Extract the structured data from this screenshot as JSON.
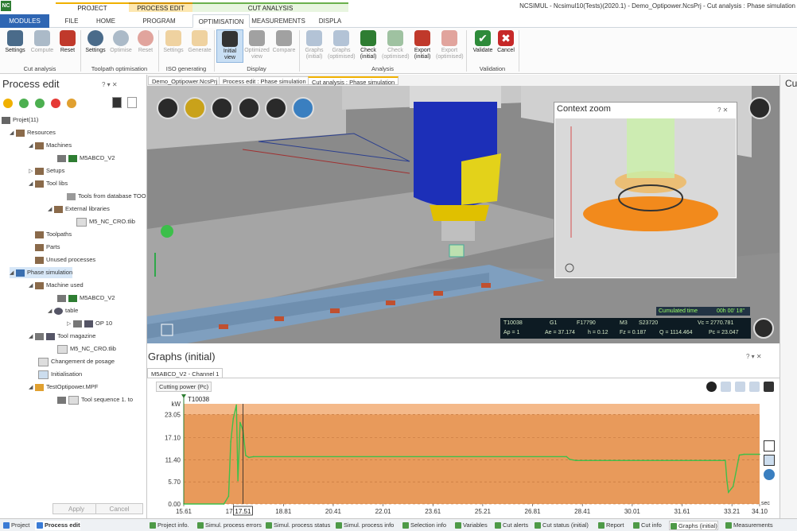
{
  "window": {
    "logo": "NC",
    "title": "NCSIMUL - Ncsimul10(Tests)(2020.1) - Demo_Optipower.NcsPrj - Cut analysis : Phase simulation",
    "context_groups": [
      "PROJECT",
      "PROCESS EDIT",
      "CUT ANALYSIS"
    ]
  },
  "ribbon": {
    "tabs": [
      "MODULES",
      "FILE",
      "HOME",
      "PROGRAM",
      "OPTIMISATION",
      "MEASUREMENTS",
      "DISPLA"
    ],
    "buttons": [
      {
        "label": "Settings",
        "icon": "settings-icon",
        "color": "#4a6b8a"
      },
      {
        "label": "Compute",
        "icon": "compute-icon",
        "color": "#4a6b8a"
      },
      {
        "label": "Reset",
        "icon": "reset-icon",
        "color": "#c0392b"
      },
      {
        "label": "Settings",
        "icon": "gauge-settings-icon",
        "color": "#4a6b8a"
      },
      {
        "label": "Optimise",
        "icon": "optimise-icon",
        "color": "#4a6b8a"
      },
      {
        "label": "Reset",
        "icon": "reset-icon",
        "color": "#c0392b"
      },
      {
        "label": "Settings",
        "icon": "iso-settings-icon",
        "color": "#e0a030"
      },
      {
        "label": "Generate",
        "icon": "generate-icon",
        "color": "#e0a030"
      },
      {
        "label": "Initial view",
        "icon": "initial-view-icon",
        "color": "#333"
      },
      {
        "label": "Optimized view",
        "icon": "optimized-view-icon",
        "color": "#333"
      },
      {
        "label": "Compare",
        "icon": "compare-icon",
        "color": "#333"
      },
      {
        "label": "Graphs (initial)",
        "icon": "graphs-initial-icon",
        "color": "#5a7fa8"
      },
      {
        "label": "Graphs (optimised)",
        "icon": "graphs-optimised-icon",
        "color": "#5a7fa8"
      },
      {
        "label": "Check (initial)",
        "icon": "check-initial-icon",
        "color": "#2e7d32"
      },
      {
        "label": "Check (optimised)",
        "icon": "check-optimised-icon",
        "color": "#2e7d32"
      },
      {
        "label": "Export (initial)",
        "icon": "export-initial-icon",
        "color": "#c0392b"
      },
      {
        "label": "Export (optimised)",
        "icon": "export-optimised-icon",
        "color": "#c0392b"
      },
      {
        "label": "Validate",
        "icon": "validate-icon",
        "color": "#2e8b3a"
      },
      {
        "label": "Cancel",
        "icon": "cancel-icon",
        "color": "#c62828"
      }
    ],
    "groups": [
      "Cut analysis",
      "Toolpath optimisation",
      "ISO generating",
      "Display",
      "Analysis",
      "Validation"
    ]
  },
  "left_panel": {
    "title": "Process edit",
    "controls": "? ▾ ✕",
    "tree": [
      {
        "label": "Projet(11)",
        "level": 0
      },
      {
        "label": "Resources",
        "level": 1
      },
      {
        "label": "Machines",
        "level": 2
      },
      {
        "label": "M5ABCD_V2",
        "level": 3
      },
      {
        "label": "Setups",
        "level": 2
      },
      {
        "label": "Tool libs",
        "level": 2
      },
      {
        "label": "Tools from database TOO",
        "level": 3
      },
      {
        "label": "External libraries",
        "level": 3
      },
      {
        "label": "M5_NC_CRO.tlib",
        "level": 4
      },
      {
        "label": "Toolpaths",
        "level": 2
      },
      {
        "label": "Parts",
        "level": 2
      },
      {
        "label": "Unused processes",
        "level": 2
      },
      {
        "label": "Phase simulation",
        "level": 0
      },
      {
        "label": "Machine used",
        "level": 1
      },
      {
        "label": "M5ABCD_V2",
        "level": 2
      },
      {
        "label": "table",
        "level": 2
      },
      {
        "label": "OP 10",
        "level": 3
      },
      {
        "label": "Tool magazine",
        "level": 1
      },
      {
        "label": "M5_NC_CRO.tlib",
        "level": 2
      },
      {
        "label": "Changement de posage",
        "level": 1
      },
      {
        "label": "Initialisation",
        "level": 1
      },
      {
        "label": "TestOptipower.MPF",
        "level": 1
      },
      {
        "label": "Tool sequence 1. to",
        "level": 2
      }
    ],
    "apply": "Apply",
    "cancel": "Cancel",
    "bottom_tabs": [
      "Project",
      "Process edit"
    ]
  },
  "doc_tabs": [
    "Demo_Optipower.NcsPrj",
    "Process edit : Phase simulation",
    "Cut analysis : Phase simulation"
  ],
  "viewport": {
    "context_zoom": {
      "title": "Context zoom",
      "controls": "?  ✕"
    },
    "cumulated_time": {
      "label": "Cumulated time",
      "value": "00h 00' 18\""
    },
    "info_row1": [
      "T10038",
      "G1",
      "F17790",
      "M3",
      "S23720",
      "Vc = 2770.781"
    ],
    "info_row2": [
      "Ap = 1",
      "Ae = 37.174",
      "h = 0.12",
      "Fz = 0.187",
      "Q = 1114.464",
      "Pc = 23.047"
    ]
  },
  "graphs": {
    "title": "Graphs (initial)",
    "controls": "? ▾ ✕",
    "tab": "M5ABCD_V2 - Channel 1",
    "selector": "Cutting power (Pc)",
    "cursor_label": "17.51"
  },
  "right_strip": {
    "label": "Cu"
  },
  "status_tabs": [
    "Project info.",
    "Simul. process errors",
    "Simul. process status",
    "Simul. process info",
    "Selection info",
    "Variables",
    "Cut alerts",
    "Cut status (initial)",
    "Report",
    "Cut info",
    "Graphs (initial)",
    "Measurements"
  ],
  "chart_data": {
    "type": "area",
    "title": "",
    "tool_label": "T10038",
    "ylabel": "kW",
    "xlabel": "sec",
    "ylim": [
      0,
      25.8
    ],
    "xlim": [
      15.61,
      34.1
    ],
    "y_ticks": [
      "0.00",
      "5.70",
      "11.40",
      "17.10",
      "23.05"
    ],
    "x_ticks": [
      "15.61",
      "17.21",
      "18.81",
      "20.41",
      "22.01",
      "23.61",
      "25.21",
      "26.81",
      "28.41",
      "30.01",
      "31.61",
      "33.21",
      "34.10"
    ],
    "x": [
      15.61,
      16.9,
      17.05,
      17.12,
      17.2,
      17.3,
      17.35,
      17.42,
      17.51,
      17.6,
      17.7,
      17.85,
      27.9,
      28.0,
      28.2,
      33.0,
      33.05,
      33.1,
      33.25,
      33.45,
      33.6,
      34.1
    ],
    "y": [
      0,
      0,
      2.0,
      16.0,
      22.0,
      25.5,
      6.0,
      21.0,
      19.0,
      12.5,
      12.0,
      12.2,
      12.2,
      11.5,
      11.2,
      11.2,
      6.0,
      3.0,
      4.5,
      12.6,
      12.8,
      12.8
    ],
    "colors": {
      "fill": "#e89a5b",
      "line": "#3fbf4a",
      "band": "#f4b98a"
    }
  }
}
